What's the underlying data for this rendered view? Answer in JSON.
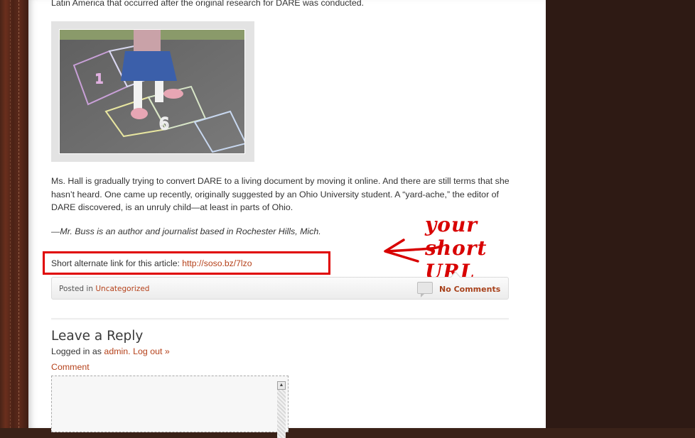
{
  "article": {
    "top_text": "Latin America that occurred after the original research for DARE was conducted.",
    "image_alt": "hopscotch-photo",
    "paragraph": "Ms. Hall is gradually trying to convert DARE to a living document by moving it online. And there are still terms that she hasn’t heard. One came up recently, originally suggested by an Ohio University student. A “yard-ache,” the editor of DARE discovered, is an unruly child—at least in parts of Ohio.",
    "byline": "—Mr. Buss is an author and journalist based in Rochester Hills, Mich."
  },
  "shortlink": {
    "label": "Short alternate link for this article: ",
    "url": "http://soso.bz/7lzo"
  },
  "annotation": {
    "text": "your short URL",
    "color": "#d80000"
  },
  "postmeta": {
    "posted_in_label": "Posted in",
    "category": "Uncategorized",
    "comments_label": "No Comments",
    "comment_icon": "comment-bubble-icon"
  },
  "reply": {
    "title": "Leave a Reply",
    "logged_in_prefix": "Logged in as",
    "username": "admin.",
    "logout": "Log out »",
    "comment_label": "Comment",
    "comment_value": ""
  },
  "colors": {
    "link": "#b5411a",
    "background": "#3a2218",
    "highlight_box": "#e00000"
  }
}
